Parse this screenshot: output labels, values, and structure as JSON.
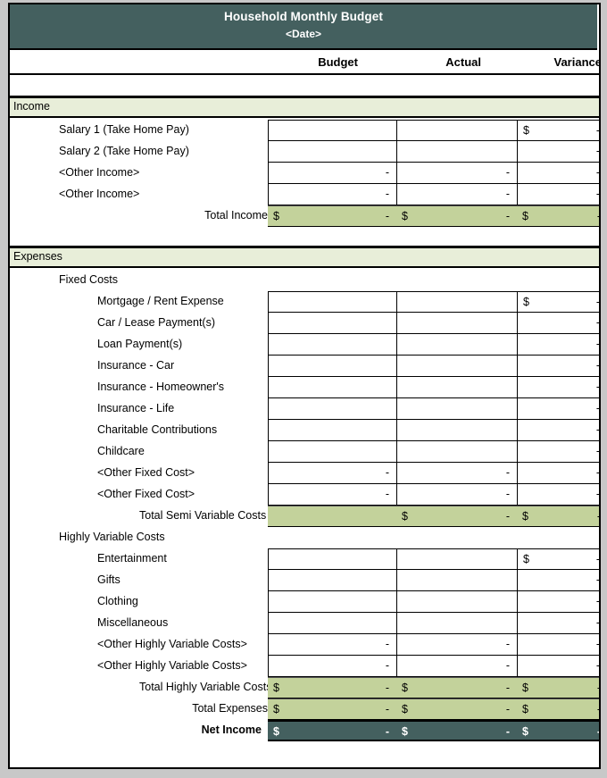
{
  "document": {
    "title": "Household Monthly Budget",
    "subtitle": "<Date>",
    "columns": {
      "budget": "Budget",
      "actual": "Actual",
      "variance": "Variance"
    },
    "currency_symbol": "$",
    "empty_value": "-"
  },
  "colors": {
    "header_fill": "#44605f",
    "header_text": "#ffffff",
    "section_band_fill": "#e8eed9",
    "total_row_fill": "#c3d29b",
    "net_income_fill": "#44605f",
    "grid_line": "#000000",
    "page_background": "#c8c8c8",
    "sheet_background": "#ffffff"
  },
  "sections": {
    "income": {
      "band_label": "Income",
      "items": [
        {
          "label": "Salary 1 (Take Home Pay)",
          "budget": "",
          "actual": "",
          "variance": "-",
          "variance_currency": "$"
        },
        {
          "label": "Salary 2 (Take Home Pay)",
          "budget": "",
          "actual": "",
          "variance": "-",
          "variance_currency": ""
        },
        {
          "label": "<Other Income>",
          "budget": "-",
          "actual": "-",
          "variance": "-",
          "variance_currency": ""
        },
        {
          "label": "<Other Income>",
          "budget": "-",
          "actual": "-",
          "variance": "-",
          "variance_currency": ""
        }
      ],
      "total": {
        "label": "Total Income",
        "budget": "-",
        "budget_currency": "$",
        "actual": "-",
        "actual_currency": "$",
        "variance": "-",
        "variance_currency": "$"
      }
    },
    "expenses": {
      "band_label": "Expenses",
      "fixed": {
        "group_label": "Fixed Costs",
        "items": [
          {
            "label": "Mortgage / Rent Expense",
            "budget": "",
            "actual": "",
            "variance": "-",
            "variance_currency": "$"
          },
          {
            "label": "Car / Lease Payment(s)",
            "budget": "",
            "actual": "",
            "variance": "-",
            "variance_currency": ""
          },
          {
            "label": "Loan Payment(s)",
            "budget": "",
            "actual": "",
            "variance": "-",
            "variance_currency": ""
          },
          {
            "label": "Insurance - Car",
            "budget": "",
            "actual": "",
            "variance": "-",
            "variance_currency": ""
          },
          {
            "label": "Insurance - Homeowner's",
            "budget": "",
            "actual": "",
            "variance": "-",
            "variance_currency": ""
          },
          {
            "label": "Insurance - Life",
            "budget": "",
            "actual": "",
            "variance": "-",
            "variance_currency": ""
          },
          {
            "label": "Charitable Contributions",
            "budget": "",
            "actual": "",
            "variance": "-",
            "variance_currency": ""
          },
          {
            "label": "Childcare",
            "budget": "",
            "actual": "",
            "variance": "-",
            "variance_currency": ""
          },
          {
            "label": "<Other Fixed Cost>",
            "budget": "-",
            "actual": "-",
            "variance": "-",
            "variance_currency": ""
          },
          {
            "label": "<Other Fixed Cost>",
            "budget": "-",
            "actual": "-",
            "variance": "-",
            "variance_currency": ""
          }
        ],
        "total": {
          "label": "Total Semi Variable Costs",
          "budget": "",
          "budget_currency": "",
          "actual": "-",
          "actual_currency": "$",
          "variance": "-",
          "variance_currency": "$"
        }
      },
      "variable": {
        "group_label": "Highly Variable Costs",
        "items": [
          {
            "label": "Entertainment",
            "budget": "",
            "actual": "",
            "variance": "-",
            "variance_currency": "$"
          },
          {
            "label": "Gifts",
            "budget": "",
            "actual": "",
            "variance": "-",
            "variance_currency": ""
          },
          {
            "label": "Clothing",
            "budget": "",
            "actual": "",
            "variance": "-",
            "variance_currency": ""
          },
          {
            "label": "Miscellaneous",
            "budget": "",
            "actual": "",
            "variance": "-",
            "variance_currency": ""
          },
          {
            "label": "<Other Highly Variable Costs>",
            "budget": "-",
            "actual": "-",
            "variance": "-",
            "variance_currency": ""
          },
          {
            "label": "<Other Highly Variable Costs>",
            "budget": "-",
            "actual": "-",
            "variance": "-",
            "variance_currency": ""
          }
        ],
        "total": {
          "label": "Total Highly Variable Costs",
          "budget": "-",
          "budget_currency": "$",
          "actual": "-",
          "actual_currency": "$",
          "variance": "-",
          "variance_currency": "$"
        }
      },
      "total_expenses": {
        "label": "Total Expenses",
        "budget": "-",
        "budget_currency": "$",
        "actual": "-",
        "actual_currency": "$",
        "variance": "-",
        "variance_currency": "$"
      }
    },
    "net_income": {
      "label": "Net Income",
      "budget": "-",
      "budget_currency": "$",
      "actual": "-",
      "actual_currency": "$",
      "variance": "-",
      "variance_currency": "$"
    }
  }
}
